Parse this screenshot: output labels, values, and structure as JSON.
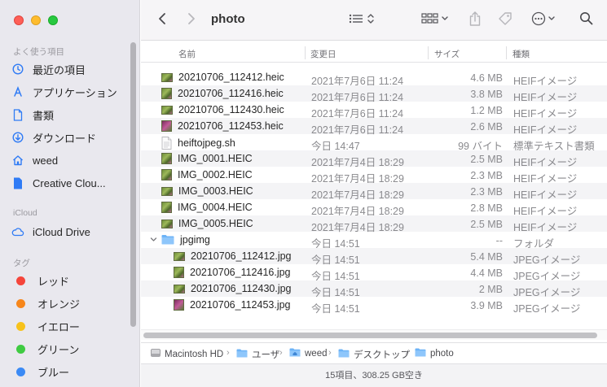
{
  "window": {
    "title": "photo"
  },
  "sidebar": {
    "favorites_header": "よく使う項目",
    "favorites": [
      {
        "label": "最近の項目",
        "icon": "clock-icon"
      },
      {
        "label": "アプリケーション",
        "icon": "applications-icon"
      },
      {
        "label": "書類",
        "icon": "document-icon"
      },
      {
        "label": "ダウンロード",
        "icon": "download-icon"
      },
      {
        "label": "weed",
        "icon": "home-icon"
      },
      {
        "label": "Creative Clou...",
        "icon": "file-icon"
      }
    ],
    "icloud_header": "iCloud",
    "icloud": [
      {
        "label": "iCloud Drive",
        "icon": "cloud-icon"
      }
    ],
    "tags_header": "タグ",
    "tags": [
      {
        "label": "レッド",
        "color": "#f5453b"
      },
      {
        "label": "オレンジ",
        "color": "#f7861b"
      },
      {
        "label": "イエロー",
        "color": "#f7c21b"
      },
      {
        "label": "グリーン",
        "color": "#3fcb42"
      },
      {
        "label": "ブルー",
        "color": "#3b8af5"
      }
    ]
  },
  "columns": {
    "name": "名前",
    "date": "変更日",
    "size": "サイズ",
    "kind": "種類"
  },
  "files": [
    {
      "name": "20210706_112412.heic",
      "date": "2021年7月6日 11:24",
      "size": "4.6 MB",
      "kind": "HEIFイメージ",
      "icon": "image-thumbnail",
      "indent": 0
    },
    {
      "name": "20210706_112416.heic",
      "date": "2021年7月6日 11:24",
      "size": "3.8 MB",
      "kind": "HEIFイメージ",
      "icon": "image-thumbnail",
      "indent": 0
    },
    {
      "name": "20210706_112430.heic",
      "date": "2021年7月6日 11:24",
      "size": "1.2 MB",
      "kind": "HEIFイメージ",
      "icon": "image-thumbnail",
      "indent": 0
    },
    {
      "name": "20210706_112453.heic",
      "date": "2021年7月6日 11:24",
      "size": "2.6 MB",
      "kind": "HEIFイメージ",
      "icon": "image-thumbnail",
      "indent": 0
    },
    {
      "name": "heiftojpeg.sh",
      "date": "今日 14:47",
      "size": "99 バイト",
      "kind": "標準テキスト書類",
      "icon": "text-file",
      "indent": 0
    },
    {
      "name": "IMG_0001.HEIC",
      "date": "2021年7月4日 18:29",
      "size": "2.5 MB",
      "kind": "HEIFイメージ",
      "icon": "image-thumbnail",
      "indent": 0
    },
    {
      "name": "IMG_0002.HEIC",
      "date": "2021年7月4日 18:29",
      "size": "2.3 MB",
      "kind": "HEIFイメージ",
      "icon": "image-thumbnail",
      "indent": 0
    },
    {
      "name": "IMG_0003.HEIC",
      "date": "2021年7月4日 18:29",
      "size": "2.3 MB",
      "kind": "HEIFイメージ",
      "icon": "image-thumbnail-wide",
      "indent": 0
    },
    {
      "name": "IMG_0004.HEIC",
      "date": "2021年7月4日 18:29",
      "size": "2.8 MB",
      "kind": "HEIFイメージ",
      "icon": "image-thumbnail",
      "indent": 0
    },
    {
      "name": "IMG_0005.HEIC",
      "date": "2021年7月4日 18:29",
      "size": "2.5 MB",
      "kind": "HEIFイメージ",
      "icon": "image-thumbnail-wide",
      "indent": 0
    },
    {
      "name": "jpgimg",
      "date": "今日 14:51",
      "size": "--",
      "kind": "フォルダ",
      "icon": "folder",
      "indent": 0,
      "expanded": true
    },
    {
      "name": "20210706_112412.jpg",
      "date": "今日 14:51",
      "size": "5.4 MB",
      "kind": "JPEGイメージ",
      "icon": "image-thumbnail",
      "indent": 1
    },
    {
      "name": "20210706_112416.jpg",
      "date": "今日 14:51",
      "size": "4.4 MB",
      "kind": "JPEGイメージ",
      "icon": "image-thumbnail",
      "indent": 1
    },
    {
      "name": "20210706_112430.jpg",
      "date": "今日 14:51",
      "size": "2 MB",
      "kind": "JPEGイメージ",
      "icon": "image-thumbnail",
      "indent": 1
    },
    {
      "name": "20210706_112453.jpg",
      "date": "今日 14:51",
      "size": "3.9 MB",
      "kind": "JPEGイメージ",
      "icon": "image-thumbnail-pink",
      "indent": 1
    }
  ],
  "pathbar": [
    {
      "label": "Macintosh HD",
      "icon": "hard-drive-icon"
    },
    {
      "label": "ユーザ",
      "icon": "folder-icon"
    },
    {
      "label": "weed",
      "icon": "home-folder-icon"
    },
    {
      "label": "デスクトップ",
      "icon": "folder-icon"
    },
    {
      "label": "photo",
      "icon": "folder-icon"
    }
  ],
  "status": "15項目、308.25 GB空き"
}
